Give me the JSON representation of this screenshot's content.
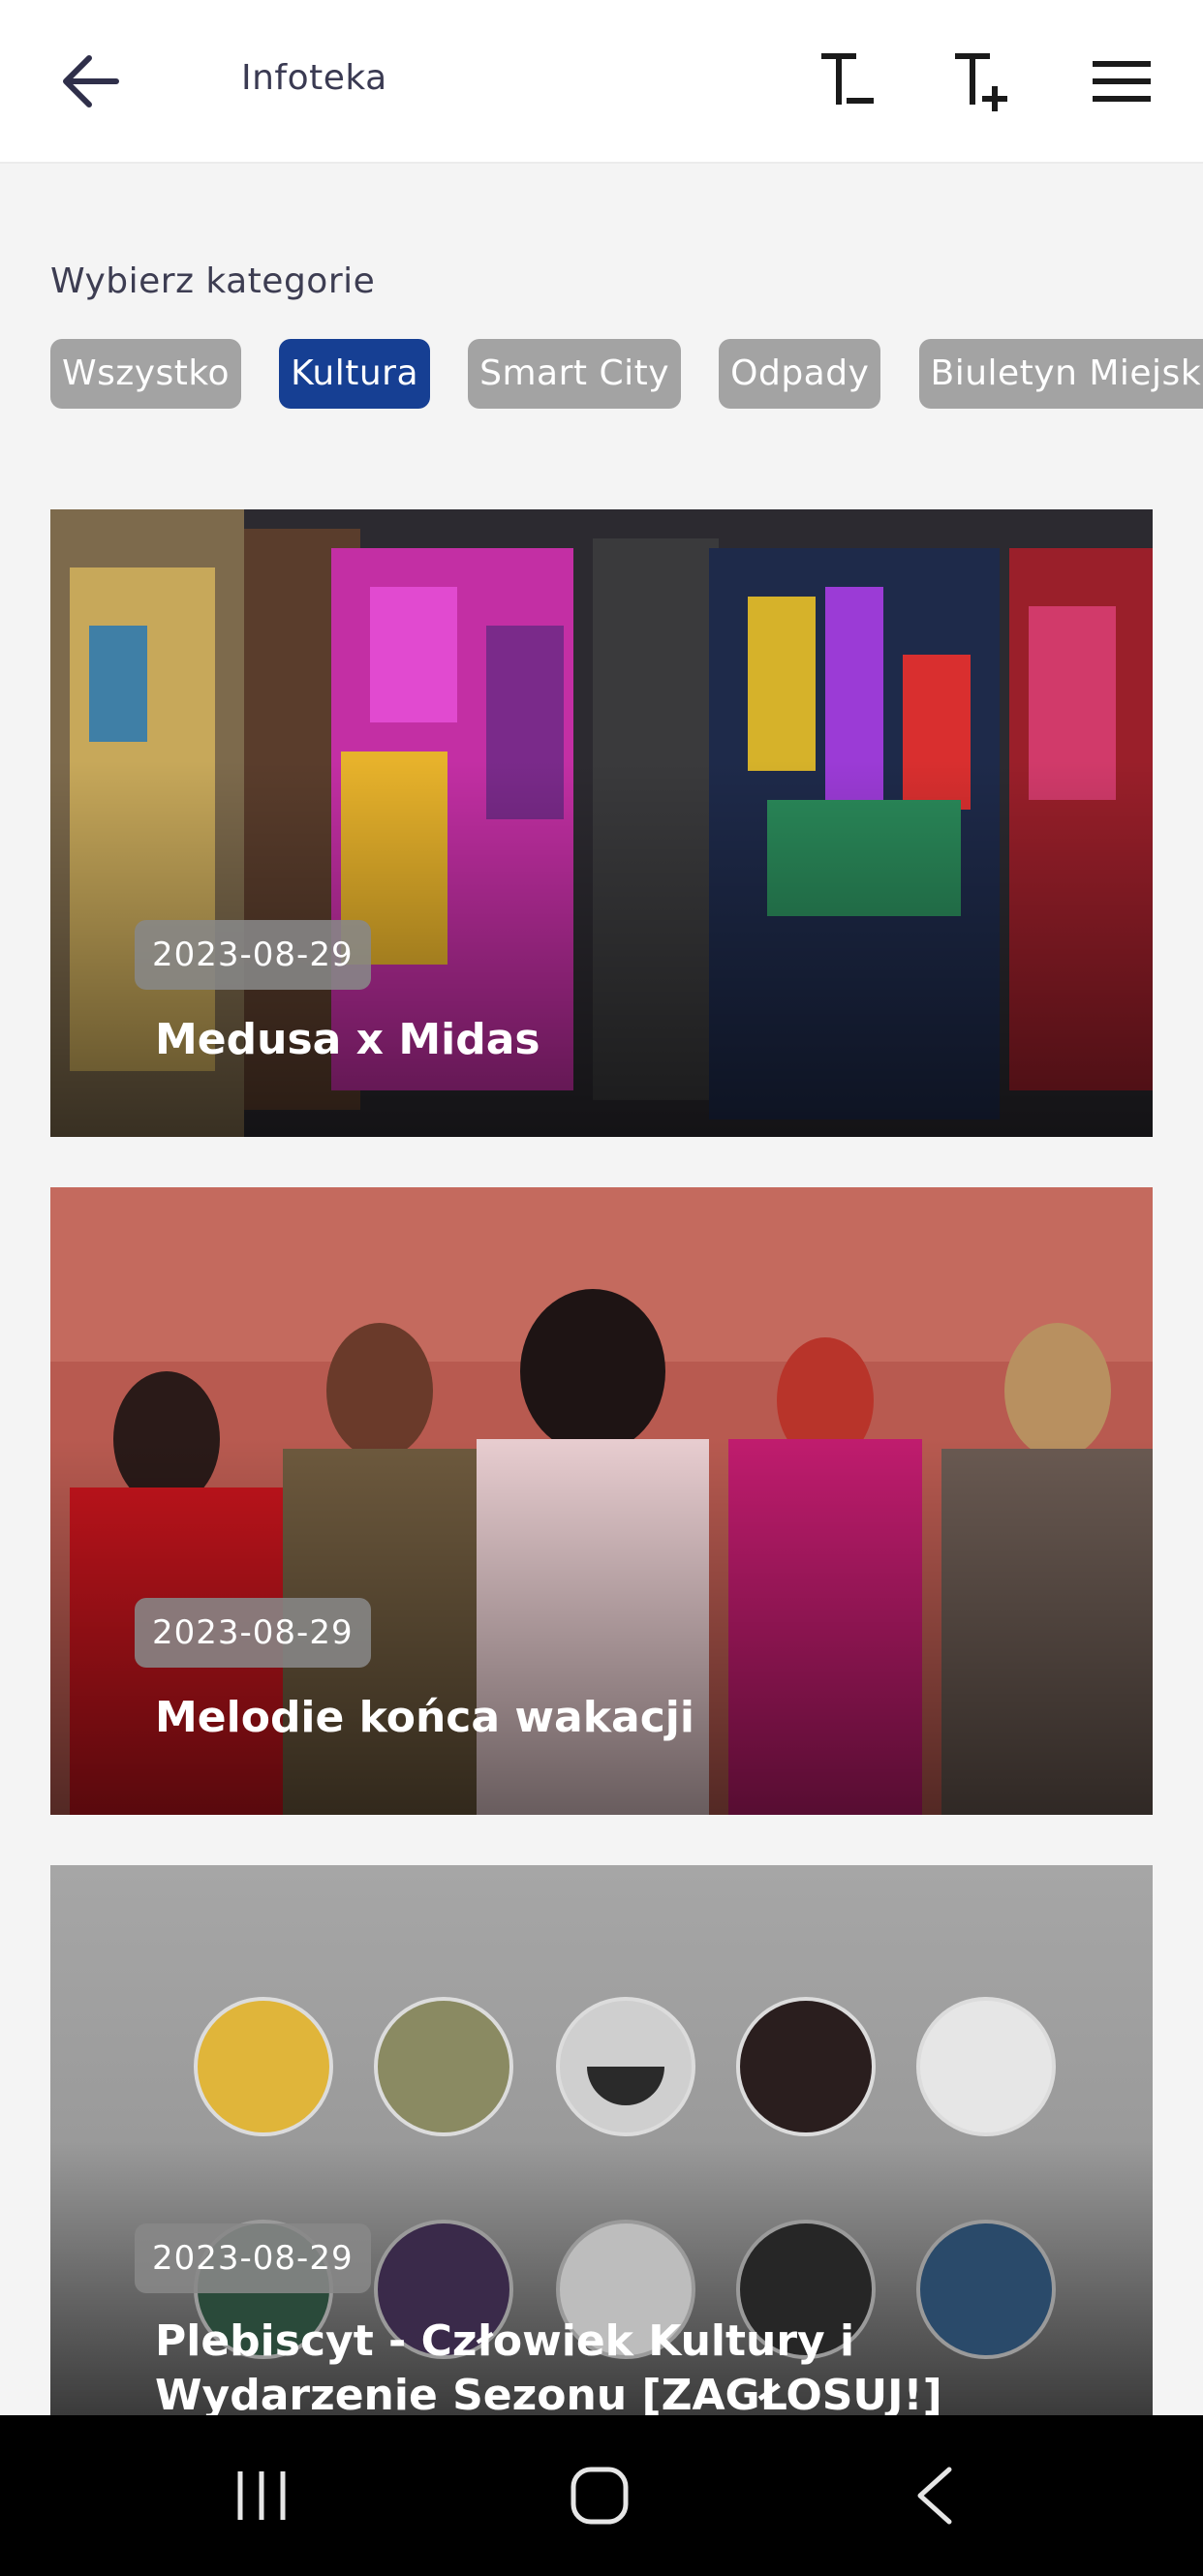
{
  "header": {
    "title": "Infoteka",
    "icons": {
      "back": "arrow-left",
      "decrease_text": "text-size-decrease",
      "increase_text": "text-size-increase",
      "menu": "hamburger-menu"
    }
  },
  "categories": {
    "label": "Wybierz kategorie",
    "chips": [
      {
        "label": "Wszystko",
        "active": false
      },
      {
        "label": "Kultura",
        "active": true
      },
      {
        "label": "Smart City",
        "active": false
      },
      {
        "label": "Odpady",
        "active": false
      },
      {
        "label": "Biuletyn Miejski",
        "active": false
      }
    ]
  },
  "articles": [
    {
      "date": "2023-08-29",
      "title": "Medusa x Midas"
    },
    {
      "date": "2023-08-29",
      "title": "Melodie końca wakacji"
    },
    {
      "date": "2023-08-29",
      "title": "Plebiscyt - Człowiek Kultury i Wydarzenie Sezonu [ZAGŁOSUJ!]"
    }
  ],
  "colors": {
    "accent": "#163f93",
    "chip_inactive": "#a3a3a3",
    "background": "#f4f4f4",
    "navbar": "#000000"
  },
  "navbar": {
    "icons": [
      "recent-apps",
      "home",
      "back"
    ]
  }
}
